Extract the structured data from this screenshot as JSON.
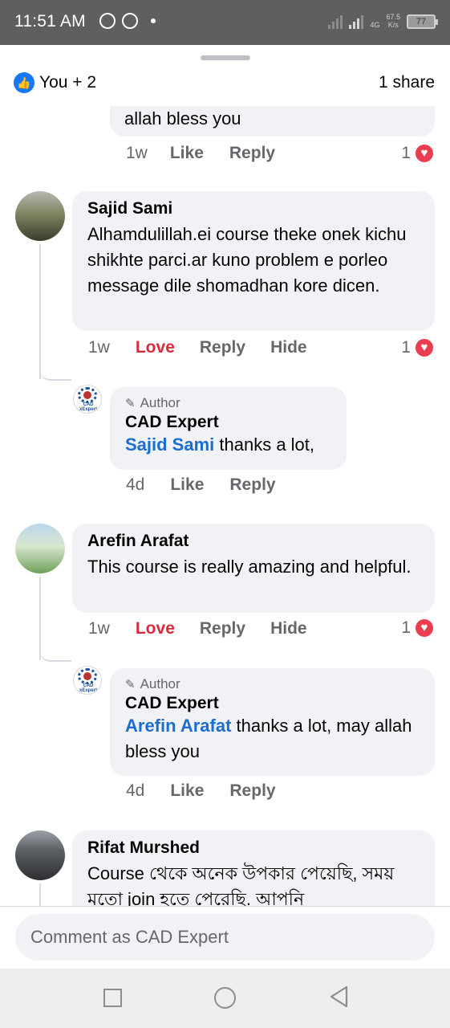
{
  "status_bar": {
    "time": "11:51 AM",
    "network": "4G",
    "speed": "67.5",
    "speed_unit": "K/s",
    "battery": "77",
    "icons": [
      "messenger-icon",
      "whatsapp-icon",
      "dot-icon",
      "signal-icon",
      "battery-icon"
    ]
  },
  "reactions": {
    "icon": "like-icon",
    "label": "You + 2",
    "shares": "1 share"
  },
  "comments": [
    {
      "tail_text": "allah bless you",
      "time": "1w",
      "like": "Like",
      "reply": "Reply",
      "reaction_count": "1"
    },
    {
      "name": "Sajid Sami",
      "text": "Alhamdulillah.ei course theke onek kichu shikhte parci.ar kuno problem e porleo message dile shomadhan kore dicen.",
      "time": "1w",
      "love": "Love",
      "reply": "Reply",
      "hide": "Hide",
      "reaction_count": "1",
      "reply_item": {
        "badge": "Author",
        "name": "CAD Expert",
        "mention": "Sajid Sami",
        "text": " thanks a lot,",
        "time": "4d",
        "like": "Like",
        "reply": "Reply"
      }
    },
    {
      "name": "Arefin Arafat",
      "text": "This course is really amazing and helpful.",
      "time": "1w",
      "love": "Love",
      "reply": "Reply",
      "hide": "Hide",
      "reaction_count": "1",
      "reply_item": {
        "badge": "Author",
        "name": "CAD Expert",
        "mention": "Arefin Arafat",
        "text": " thanks a lot, may allah bless you",
        "time": "4d",
        "like": "Like",
        "reply": "Reply"
      }
    },
    {
      "name": "Rifat Murshed",
      "text": "Course থেকে অনেক উপকার পেয়েছি, সময় মতো join হতে পেরেছি. আপনি",
      "truncated": true
    }
  ],
  "logo_text": "CAD xExpert",
  "composer": {
    "placeholder": "Comment as CAD Expert"
  },
  "nav": [
    "recents-button",
    "home-button",
    "back-button"
  ],
  "colors": {
    "brand_blue": "#1877f2",
    "love_red": "#d92c3c",
    "bubble_bg": "#f0f2f5",
    "mention_blue": "#1a6ed1",
    "muted_text": "#65676b"
  }
}
